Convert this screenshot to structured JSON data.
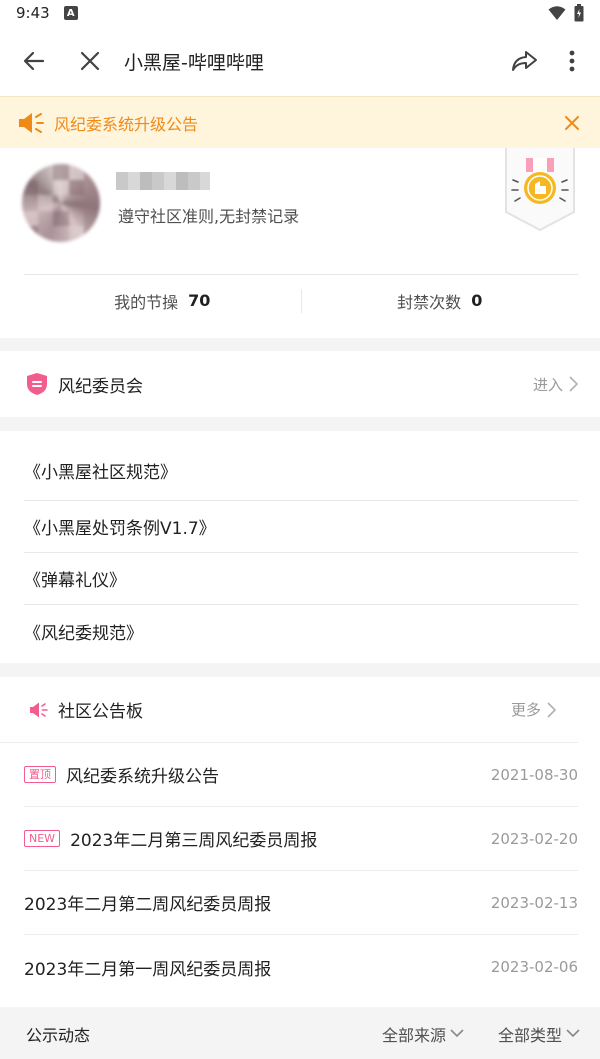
{
  "status_bar": {
    "time": "9:43",
    "notification_glyph": "A"
  },
  "top_bar": {
    "title": "小黑屋-哔哩哔哩"
  },
  "notice": {
    "text": "风纪委系统升级公告"
  },
  "profile": {
    "description": "遵守社区准则,无封禁记录",
    "stats": [
      {
        "label": "我的节操",
        "value": "70"
      },
      {
        "label": "封禁次数",
        "value": "0"
      }
    ]
  },
  "committee": {
    "label": "风纪委员会",
    "enter_label": "进入"
  },
  "rules": [
    {
      "title": "《小黑屋社区规范》"
    },
    {
      "title": "《小黑屋处罚条例V1.7》"
    },
    {
      "title": "《弹幕礼仪》"
    },
    {
      "title": "《风纪委规范》"
    }
  ],
  "board": {
    "title": "社区公告板",
    "more_label": "更多",
    "items": [
      {
        "tag": "置顶",
        "title": "风纪委系统升级公告",
        "date": "2021-08-30"
      },
      {
        "tag": "NEW",
        "title": "2023年二月第三周风纪委员周报",
        "date": "2023-02-20"
      },
      {
        "tag": "",
        "title": "2023年二月第二周风纪委员周报",
        "date": "2023-02-13"
      },
      {
        "tag": "",
        "title": "2023年二月第一周风纪委员周报",
        "date": "2023-02-06"
      }
    ]
  },
  "filters": {
    "title": "公示动态",
    "source_label": "全部来源",
    "type_label": "全部类型"
  },
  "colors": {
    "accent_pink": "#f25d8e",
    "notice_orange": "#f08a17",
    "notice_bg": "#fff4dc",
    "medal_gold": "#f5b823"
  },
  "icons": [
    "back-arrow-icon",
    "close-icon",
    "share-icon",
    "more-vertical-icon",
    "megaphone-icon",
    "shield-icon",
    "chevron-right-icon",
    "chevron-down-icon",
    "medal-icon",
    "wifi-icon",
    "battery-icon"
  ]
}
